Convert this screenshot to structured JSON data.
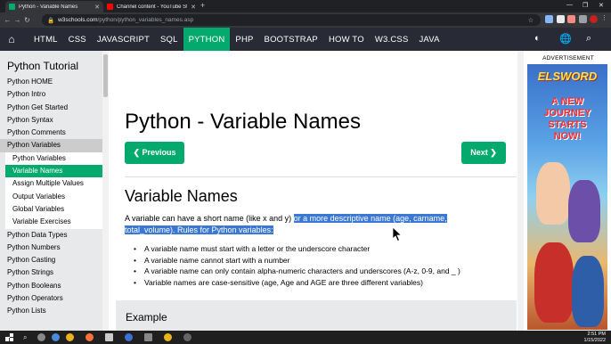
{
  "browser": {
    "tabs": [
      {
        "title": "Python - Variable Names",
        "active": true,
        "favicon_color": "#04aa6d"
      },
      {
        "title": "Channel content - YouTube Stu",
        "active": false,
        "favicon_color": "#ff0000"
      }
    ],
    "url_host": "w3schools.com",
    "url_path": "/python/python_variables_names.asp"
  },
  "topnav": {
    "items": [
      "HTML",
      "CSS",
      "JAVASCRIPT",
      "SQL",
      "PYTHON",
      "PHP",
      "BOOTSTRAP",
      "HOW TO",
      "W3.CSS",
      "JAVA"
    ],
    "active": "PYTHON"
  },
  "sidebar": {
    "heading": "Python Tutorial",
    "items": [
      {
        "label": "Python HOME"
      },
      {
        "label": "Python Intro"
      },
      {
        "label": "Python Get Started"
      },
      {
        "label": "Python Syntax"
      },
      {
        "label": "Python Comments"
      },
      {
        "label": "Python Variables"
      },
      {
        "label": "Python Variables"
      },
      {
        "label": "Variable Names"
      },
      {
        "label": "Assign Multiple Values"
      },
      {
        "label": "Output Variables"
      },
      {
        "label": "Global Variables"
      },
      {
        "label": "Variable Exercises"
      },
      {
        "label": "Python Data Types"
      },
      {
        "label": "Python Numbers"
      },
      {
        "label": "Python Casting"
      },
      {
        "label": "Python Strings"
      },
      {
        "label": "Python Booleans"
      },
      {
        "label": "Python Operators"
      },
      {
        "label": "Python Lists"
      }
    ]
  },
  "main": {
    "title": "Python - Variable Names",
    "prev_label": "❮ Previous",
    "next_label": "Next ❯",
    "section_title": "Variable Names",
    "para_plain": "A variable can have a short name (like x and y) ",
    "para_highlight": "or a more descriptive name (age, carname, total_volume). Rules for Python variables:",
    "rules": [
      "A variable name must start with a letter or the underscore character",
      "A variable name cannot start with a number",
      "A variable name can only contain alpha-numeric characters and underscores (A-z, 0-9, and _ )",
      "Variable names are case-sensitive (age, Age and AGE are three different variables)"
    ],
    "example_title": "Example"
  },
  "ad": {
    "label": "ADVERTISEMENT",
    "brand": "ELSWORD",
    "copy": [
      "A NEW",
      "JOURNEY",
      "STARTS",
      "NOW!"
    ]
  },
  "taskbar": {
    "time": "2:51 PM",
    "date": "1/15/2022"
  },
  "colors": {
    "accent": "#04aa6d",
    "topnav_bg": "#282a35",
    "sidebar_bg": "#e7e9eb",
    "highlight": "#3a78d4"
  }
}
